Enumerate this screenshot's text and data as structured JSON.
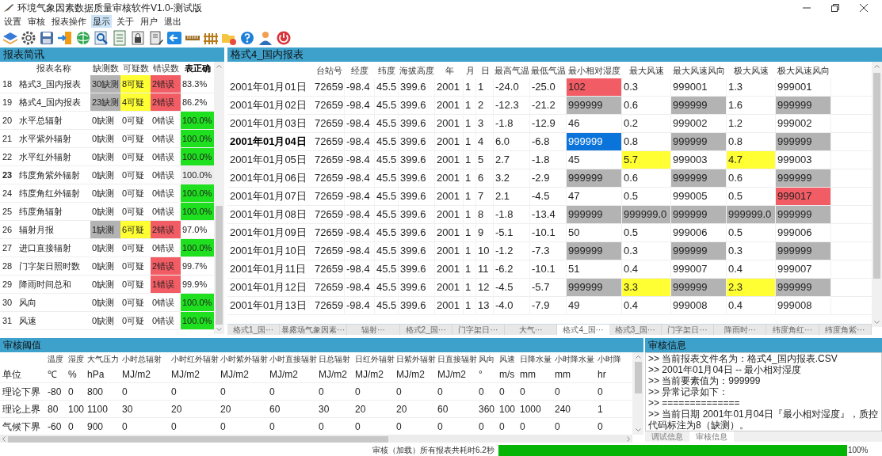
{
  "window": {
    "title": "环境气象因素数据质量审核软件V1.0-测试版"
  },
  "menu": [
    {
      "label": "设置",
      "selected": false
    },
    {
      "label": "审核",
      "selected": false
    },
    {
      "label": "报表操作",
      "selected": false
    },
    {
      "label": "显示",
      "selected": true
    },
    {
      "label": "关于",
      "selected": false
    },
    {
      "label": "用户",
      "selected": false
    },
    {
      "label": "退出",
      "selected": false
    }
  ],
  "summary": {
    "title": "报表简讯",
    "columns": [
      "报表名称",
      "缺测数",
      "可疑数",
      "错误数",
      "表正确"
    ],
    "rows": [
      {
        "no": "18",
        "selected": false,
        "cells": [
          "格式3_国内报表",
          {
            "text": "30缺测",
            "color": "#b3b3b3"
          },
          {
            "text": "8可疑",
            "color": "#ffff33"
          },
          {
            "text": "2错误",
            "color": "#f25c64"
          },
          "83.3%"
        ]
      },
      {
        "no": "19",
        "selected": false,
        "cells": [
          "格式4_国内报表",
          {
            "text": "23缺测",
            "color": "#b3b3b3"
          },
          {
            "text": "4可疑",
            "color": "#ffff33"
          },
          {
            "text": "2错误",
            "color": "#f25c64"
          },
          "86.2%"
        ]
      },
      {
        "no": "20",
        "selected": false,
        "cells": [
          "水平总辐射",
          "0缺测",
          "0可疑",
          "0错误",
          {
            "text": "100.0%",
            "color": "#1fe01f"
          }
        ]
      },
      {
        "no": "21",
        "selected": false,
        "cells": [
          "水平紫外辐射",
          "0缺测",
          "0可疑",
          "0错误",
          {
            "text": "100.0%",
            "color": "#1fe01f"
          }
        ]
      },
      {
        "no": "22",
        "selected": false,
        "cells": [
          "水平红外辐射",
          "0缺测",
          "0可疑",
          "0错误",
          {
            "text": "100.0%",
            "color": "#1fe01f"
          }
        ]
      },
      {
        "no": "23",
        "selected": true,
        "cells": [
          "纬度角紫外辐射",
          "0缺测",
          "0可疑",
          "0错误",
          {
            "text": "100.0%",
            "color": "#ececec"
          }
        ]
      },
      {
        "no": "24",
        "selected": false,
        "cells": [
          "纬度角红外辐射",
          "0缺测",
          "0可疑",
          "0错误",
          {
            "text": "100.0%",
            "color": "#1fe01f"
          }
        ]
      },
      {
        "no": "25",
        "selected": false,
        "cells": [
          "纬度角辐射",
          "0缺测",
          "0可疑",
          "0错误",
          {
            "text": "100.0%",
            "color": "#1fe01f"
          }
        ]
      },
      {
        "no": "26",
        "selected": false,
        "cells": [
          "辐射月报",
          {
            "text": "1缺测",
            "color": "#b3b3b3"
          },
          {
            "text": "6可疑",
            "color": "#ffff33"
          },
          {
            "text": "2错误",
            "color": "#f25c64"
          },
          "97.0%"
        ]
      },
      {
        "no": "27",
        "selected": false,
        "cells": [
          "进口直接辐射",
          "0缺测",
          "0可疑",
          "0错误",
          {
            "text": "100.0%",
            "color": "#1fe01f"
          }
        ]
      },
      {
        "no": "28",
        "selected": false,
        "cells": [
          "门字架日照时数",
          "0缺测",
          "0可疑",
          {
            "text": "2错误",
            "color": "#f25c64"
          },
          "99.7%"
        ]
      },
      {
        "no": "29",
        "selected": false,
        "cells": [
          "降雨时间总和",
          "0缺测",
          "0可疑",
          {
            "text": "1错误",
            "color": "#f25c64"
          },
          "99.9%"
        ]
      },
      {
        "no": "30",
        "selected": false,
        "cells": [
          "风向",
          "0缺测",
          "0可疑",
          "0错误",
          {
            "text": "100.0%",
            "color": "#1fe01f"
          }
        ]
      },
      {
        "no": "31",
        "selected": false,
        "cells": [
          "风速",
          "0缺测",
          "0可疑",
          "0错误",
          {
            "text": "100.0%",
            "color": "#1fe01f"
          }
        ]
      }
    ]
  },
  "report": {
    "title": "格式4_国内报表",
    "columns": [
      "台站号",
      "经度",
      "纬度",
      "海拔高度",
      "年",
      "月",
      "日",
      "最高气温",
      "最低气温",
      "最小相对湿度",
      "最大风速",
      "最大风速风向",
      "极大风速",
      "极大风速风向"
    ],
    "rows": [
      {
        "date": "2001年01月01日",
        "selected": false,
        "cells": [
          "72659",
          "-98.4",
          "45.5",
          "399.6",
          "2001",
          "1",
          "1",
          "-24.0",
          "-25.0",
          {
            "text": "102",
            "color": "#f25c64"
          },
          "0.3",
          "999001",
          "1.3",
          "999001"
        ]
      },
      {
        "date": "2001年01月02日",
        "selected": false,
        "cells": [
          "72659",
          "-98.4",
          "45.5",
          "399.6",
          "2001",
          "1",
          "2",
          "-12.3",
          "-21.2",
          {
            "text": "999999",
            "color": "#b3b3b3"
          },
          "0.6",
          {
            "text": "999999",
            "color": "#b3b3b3"
          },
          "1.6",
          {
            "text": "999999",
            "color": "#b3b3b3"
          }
        ]
      },
      {
        "date": "2001年01月03日",
        "selected": false,
        "cells": [
          "72659",
          "-98.4",
          "45.5",
          "399.6",
          "2001",
          "1",
          "3",
          "-1.8",
          "-12.9",
          "46",
          "0.2",
          "999002",
          "1.2",
          "999002"
        ]
      },
      {
        "date": "2001年01月04日",
        "selected": true,
        "cells": [
          "72659",
          "-98.4",
          "45.5",
          "399.6",
          "2001",
          "1",
          "4",
          "6.0",
          "-6.8",
          {
            "text": "999999",
            "color": "#0a74da"
          },
          "0.8",
          {
            "text": "999999",
            "color": "#b3b3b3"
          },
          "0.8",
          {
            "text": "999999",
            "color": "#b3b3b3"
          }
        ]
      },
      {
        "date": "2001年01月05日",
        "selected": false,
        "cells": [
          "72659",
          "-98.4",
          "45.5",
          "399.6",
          "2001",
          "1",
          "5",
          "2.7",
          "-1.8",
          "45",
          {
            "text": "5.7",
            "color": "#ffff33"
          },
          "999003",
          {
            "text": "4.7",
            "color": "#ffff33"
          },
          "999003"
        ]
      },
      {
        "date": "2001年01月06日",
        "selected": false,
        "cells": [
          "72659",
          "-98.4",
          "45.5",
          "399.6",
          "2001",
          "1",
          "6",
          "3.2",
          "-2.9",
          {
            "text": "999999",
            "color": "#b3b3b3"
          },
          "0.6",
          {
            "text": "999999",
            "color": "#b3b3b3"
          },
          "0.6",
          {
            "text": "999999",
            "color": "#b3b3b3"
          }
        ]
      },
      {
        "date": "2001年01月07日",
        "selected": false,
        "cells": [
          "72659",
          "-98.4",
          "45.5",
          "399.6",
          "2001",
          "1",
          "7",
          "2.1",
          "-4.5",
          "47",
          "0.5",
          "999005",
          "0.5",
          {
            "text": "999017",
            "color": "#f25c64"
          }
        ]
      },
      {
        "date": "2001年01月08日",
        "selected": false,
        "cells": [
          "72659",
          "-98.4",
          "45.5",
          "399.6",
          "2001",
          "1",
          "8",
          "-1.8",
          "-13.4",
          {
            "text": "999999",
            "color": "#b3b3b3"
          },
          {
            "text": "999999.0",
            "color": "#b3b3b3"
          },
          {
            "text": "999999",
            "color": "#b3b3b3"
          },
          {
            "text": "999999.0",
            "color": "#b3b3b3"
          },
          {
            "text": "999999",
            "color": "#b3b3b3"
          }
        ]
      },
      {
        "date": "2001年01月09日",
        "selected": false,
        "cells": [
          "72659",
          "-98.4",
          "45.5",
          "399.6",
          "2001",
          "1",
          "9",
          "-5.1",
          "-10.1",
          "50",
          "0.5",
          "999006",
          "0.5",
          "999006"
        ]
      },
      {
        "date": "2001年01月10日",
        "selected": false,
        "cells": [
          "72659",
          "-98.4",
          "45.5",
          "399.6",
          "2001",
          "1",
          "10",
          "-1.2",
          "-7.3",
          {
            "text": "999999",
            "color": "#b3b3b3"
          },
          "0.3",
          {
            "text": "999999",
            "color": "#b3b3b3"
          },
          "0.3",
          {
            "text": "999999",
            "color": "#b3b3b3"
          }
        ]
      },
      {
        "date": "2001年01月11日",
        "selected": false,
        "cells": [
          "72659",
          "-98.4",
          "45.5",
          "399.6",
          "2001",
          "1",
          "11",
          "-6.2",
          "-10.1",
          "51",
          "0.4",
          "999007",
          "0.4",
          "999007"
        ]
      },
      {
        "date": "2001年01月12日",
        "selected": false,
        "cells": [
          "72659",
          "-98.4",
          "45.5",
          "399.6",
          "2001",
          "1",
          "12",
          "-4.5",
          "-5.7",
          {
            "text": "999999",
            "color": "#b3b3b3"
          },
          {
            "text": "3.3",
            "color": "#ffff33"
          },
          {
            "text": "999999",
            "color": "#b3b3b3"
          },
          {
            "text": "2.3",
            "color": "#ffff33"
          },
          {
            "text": "999999",
            "color": "#b3b3b3"
          }
        ]
      },
      {
        "date": "2001年01月13日",
        "selected": false,
        "cells": [
          "72659",
          "-98.4",
          "45.5",
          "399.6",
          "2001",
          "1",
          "13",
          "-4.0",
          "-7.9",
          "49",
          "0.4",
          "999008",
          "0.4",
          "999008"
        ]
      }
    ],
    "tabs": [
      {
        "label": "格式1_国···",
        "selected": false
      },
      {
        "label": "暴露场气象因素···",
        "selected": false
      },
      {
        "label": "辐射···",
        "selected": false
      },
      {
        "label": "格式2_国···",
        "selected": false
      },
      {
        "label": "门字架日···",
        "selected": false
      },
      {
        "label": "大气···",
        "selected": false
      },
      {
        "label": "格式4_国···",
        "selected": true
      },
      {
        "label": "格式3_国···",
        "selected": false
      },
      {
        "label": "门字架日···",
        "selected": false
      },
      {
        "label": "降雨时···",
        "selected": false
      },
      {
        "label": "纬度角红···",
        "selected": false
      },
      {
        "label": "纬度角紫···",
        "selected": false
      }
    ]
  },
  "thresholds": {
    "title": "审核阈值",
    "columns": [
      "温度",
      "湿度",
      "大气压力",
      "小时总辐射",
      "小时红外辐射",
      "小时紫外辐射",
      "小时直接辐射",
      "日总辐射",
      "日红外辐射",
      "日紫外辐射",
      "日直接辐射",
      "风向",
      "风速",
      "日降水量",
      "小时降水量",
      "小时降"
    ],
    "rows": [
      {
        "label": "单位",
        "cells": [
          "℃",
          "%",
          "hPa",
          "MJ/m2",
          "MJ/m2",
          "MJ/m2",
          "MJ/m2",
          "MJ/m2",
          "MJ/m2",
          "MJ/m2",
          "MJ/m2",
          "°",
          "m/s",
          "mm",
          "mm",
          "hr"
        ]
      },
      {
        "label": "理论下界",
        "cells": [
          "-80",
          "0",
          "800",
          "0",
          "0",
          "0",
          "0",
          "0",
          "0",
          "0",
          "0",
          "0",
          "0",
          "0",
          "0",
          "0"
        ]
      },
      {
        "label": "理论上界",
        "cells": [
          "80",
          "100",
          "1100",
          "30",
          "20",
          "20",
          "60",
          "30",
          "20",
          "20",
          "60",
          "360",
          "100",
          "1000",
          "240",
          "1"
        ]
      },
      {
        "label": "气候下界",
        "cells": [
          "-60",
          "0",
          "900",
          "0",
          "0",
          "0",
          "0",
          "0",
          "0",
          "0",
          "0",
          "0",
          "0",
          "0",
          "0",
          "0"
        ]
      }
    ]
  },
  "audit_info": {
    "title": "审核信息",
    "lines": [
      ">> 当前报表文件名为：格式4_国内报表.CSV",
      ">> 2001年01月04日 -- 最小相对湿度",
      ">> 当前要素值为：999999",
      ">> 异常记录如下：",
      ">> ==============",
      ">> 当前日期 2001年01月04日『最小相对湿度』，质控代码标注为8（缺测）。"
    ],
    "tabs": [
      {
        "label": "调试信息",
        "selected": false
      },
      {
        "label": "审核信息",
        "selected": true
      }
    ]
  },
  "status_bar": {
    "message": "审核（加载）所有报表共耗时6.2秒",
    "progress": {
      "level": 1.0,
      "reading": "100%"
    }
  }
}
